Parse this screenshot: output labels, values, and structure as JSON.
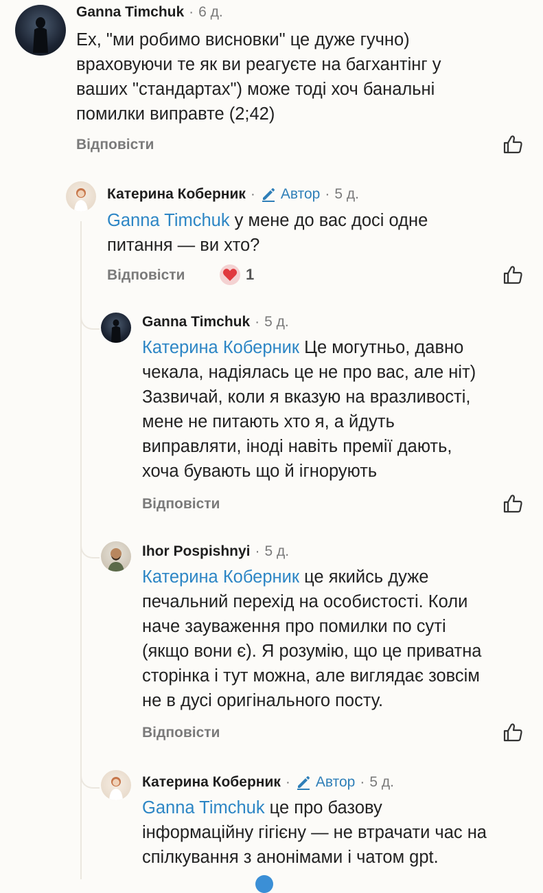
{
  "comments": [
    {
      "author": "Ganna Timchuk",
      "time": "6 д.",
      "lines": [
        "Ех, \"ми робимо висновки\" це дуже гучно)",
        "враховуючи те як ви реагуєте на багхантінг у",
        "ваших \"стандартах\") може тоді хоч банальні",
        "помилки виправте (2;42)"
      ],
      "reply": "Відповісти"
    },
    {
      "author": "Катерина Коберник",
      "badge": "Автор",
      "time": "5 д.",
      "mention": "Ganna Timchuk",
      "first_line_rest": " у мене до вас досі одне",
      "lines": [
        "питання — ви хто?"
      ],
      "reply": "Відповісти",
      "reaction_count": "1"
    },
    {
      "author": "Ganna Timchuk",
      "time": "5 д.",
      "mention": "Катерина Коберник",
      "first_line_rest": " Це могутньо, давно",
      "lines": [
        "чекала, надіялась це не про вас, але ніт)",
        "Зазвичай, коли я вказую на вразливості,",
        "мене не питають хто я, а йдуть",
        "виправляти, іноді навіть премії дають,",
        "хоча бувають що й ігнорують"
      ],
      "reply": "Відповісти"
    },
    {
      "author": "Ihor Pospishnyi",
      "time": "5 д.",
      "mention": "Катерина Коберник",
      "first_line_rest": " це якийсь дуже",
      "lines": [
        "печальний перехід на особистості. Коли",
        "наче зауваження про помилки по суті",
        "(якщо вони є). Я розумію, що це приватна",
        "сторінка і тут можна, але виглядає зовсім",
        "не в дусі оригінального посту."
      ],
      "reply": "Відповісти"
    },
    {
      "author": "Катерина Коберник",
      "badge": "Автор",
      "time": "5 д.",
      "mention": "Ganna Timchuk",
      "first_line_rest": " це про базову",
      "lines": [
        "інформаційну гігієну — не втрачати час на",
        "спілкування з анонімами і чатом gpt."
      ]
    }
  ],
  "separator_dot": "·",
  "icons": {
    "like": "thumbs-up-icon",
    "author_badge": "pencil-icon",
    "reaction": "heart-icon"
  },
  "colors": {
    "mention": "#2d86c5",
    "badge": "#2f7fb8",
    "muted": "#7a7a7a",
    "heart": "#e0393e"
  }
}
